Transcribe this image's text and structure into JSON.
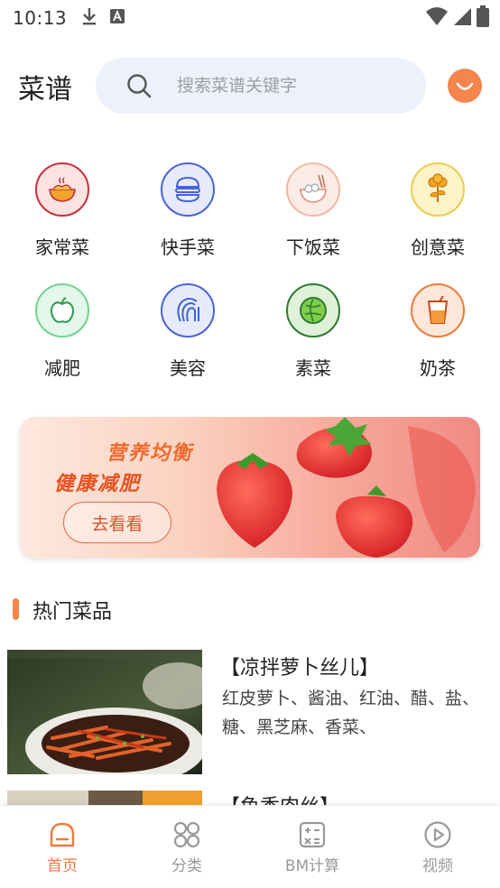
{
  "status_bar": {
    "time": "10:13",
    "icons": [
      "download-icon",
      "a-notification-icon",
      "wifi-icon",
      "signal-icon",
      "battery-icon"
    ]
  },
  "header": {
    "title": "菜谱",
    "search_placeholder": "搜索菜谱关键字",
    "search_value": ""
  },
  "categories": [
    {
      "label": "家常菜",
      "icon": "bowl-icon",
      "color": "#c9303a"
    },
    {
      "label": "快手菜",
      "icon": "burger-icon",
      "color": "#4a62d8"
    },
    {
      "label": "下饭菜",
      "icon": "rice-bowl-icon",
      "color": "#e08a6a"
    },
    {
      "label": "创意菜",
      "icon": "bulb-leaf-icon",
      "color": "#e0b21e"
    },
    {
      "label": "减肥",
      "icon": "apple-icon",
      "color": "#3fb86a"
    },
    {
      "label": "美容",
      "icon": "face-icon",
      "color": "#3a66d6"
    },
    {
      "label": "素菜",
      "icon": "cabbage-icon",
      "color": "#2f9a3e"
    },
    {
      "label": "奶茶",
      "icon": "milk-tea-icon",
      "color": "#ef7a3c"
    }
  ],
  "banner": {
    "line1": "营养均衡",
    "line2": "健康减肥",
    "button_label": "去看看"
  },
  "section": {
    "title": "热门菜品"
  },
  "recipes": [
    {
      "title": "【凉拌萝卜丝儿】",
      "desc": "红皮萝卜、酱油、红油、醋、盐、糖、黑芝麻、香菜、"
    },
    {
      "title": "【鱼香肉丝】",
      "desc": ""
    }
  ],
  "tabs": [
    {
      "label": "首页",
      "icon": "home-icon",
      "active": true
    },
    {
      "label": "分类",
      "icon": "grid-icon",
      "active": false
    },
    {
      "label": "BM计算",
      "icon": "calculator-icon",
      "active": false
    },
    {
      "label": "视频",
      "icon": "play-icon",
      "active": false
    }
  ],
  "colors": {
    "accent": "#f4854d",
    "search_bg": "#eef1fb",
    "tab_active": "#ef7a3c",
    "tab_inactive": "#999999"
  }
}
